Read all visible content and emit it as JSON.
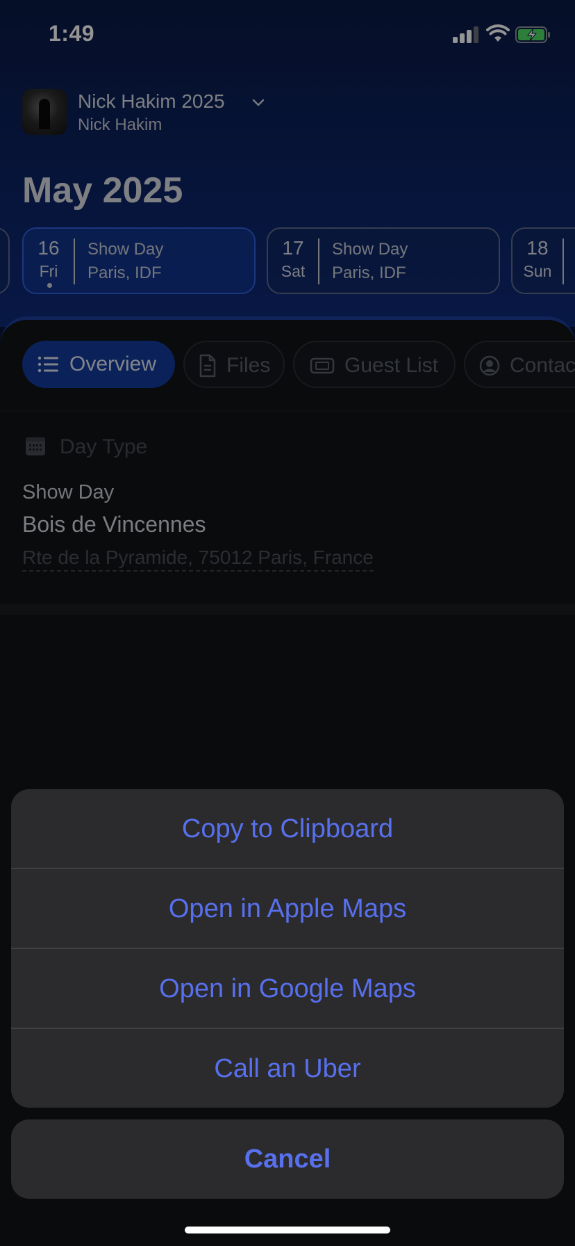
{
  "status_bar": {
    "time": "1:49"
  },
  "project": {
    "name": "Nick Hakim 2025",
    "artist": "Nick Hakim"
  },
  "month_title": "May 2025",
  "dates": [
    {
      "num": "16",
      "dow": "Fri",
      "type": "Show Day",
      "location": "Paris, IDF",
      "active": true
    },
    {
      "num": "17",
      "dow": "Sat",
      "type": "Show Day",
      "location": "Paris, IDF",
      "active": false
    },
    {
      "num": "18",
      "dow": "Sun",
      "type": "",
      "location": "",
      "active": false
    }
  ],
  "tabs": [
    {
      "label": "Overview",
      "icon": "list-icon",
      "active": true
    },
    {
      "label": "Files",
      "icon": "document-icon",
      "active": false
    },
    {
      "label": "Guest List",
      "icon": "ticket-icon",
      "active": false
    },
    {
      "label": "Contac",
      "icon": "person-circle-icon",
      "active": false
    }
  ],
  "overview": {
    "section_label": "Day Type",
    "day_type": "Show Day",
    "venue": "Bois de Vincennes",
    "address": "Rte de la Pyramide, 75012 Paris, France"
  },
  "action_sheet": {
    "items": [
      "Copy to Clipboard",
      "Open in Apple Maps",
      "Open in Google Maps",
      "Call an Uber"
    ],
    "cancel": "Cancel"
  },
  "colors": {
    "accent": "#5870ee",
    "header_blue": "#0d2466",
    "active_tab": "#143a9a",
    "sheet_bg": "#2b2b2d"
  }
}
